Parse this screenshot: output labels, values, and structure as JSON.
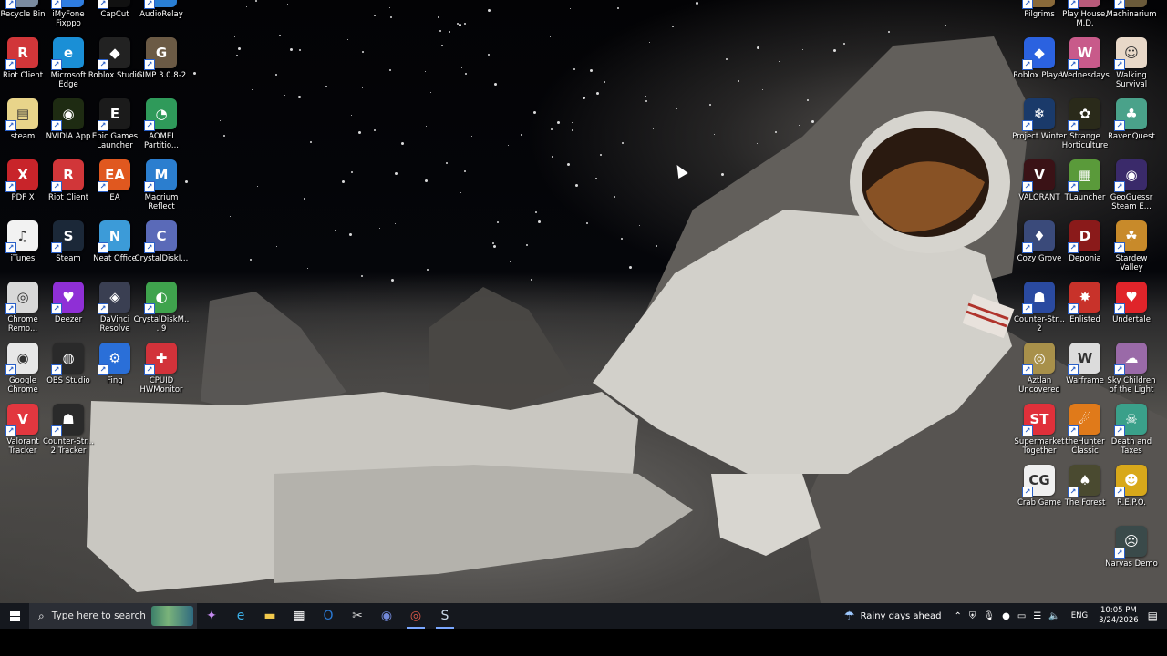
{
  "left_icons": [
    {
      "label": "Recycle Bin",
      "icon": "recycle-bin-icon",
      "color": "#7a8ba0",
      "glyph": "🗑"
    },
    {
      "label": "iMyFone Fixppo",
      "icon": "imyfone-fixppo-icon",
      "color": "#2f7de1",
      "glyph": "F"
    },
    {
      "label": "CapCut",
      "icon": "capcut-icon",
      "color": "#111111",
      "glyph": "✂"
    },
    {
      "label": "AudioRelay",
      "icon": "audiorelay-icon",
      "color": "#2a7fd4",
      "glyph": "♪"
    },
    {
      "label": "Riot Client",
      "icon": "riot-client-icon",
      "color": "#d13639",
      "glyph": "R"
    },
    {
      "label": "Microsoft Edge",
      "icon": "microsoft-edge-icon",
      "color": "#1a8fd6",
      "glyph": "e"
    },
    {
      "label": "Roblox Studio",
      "icon": "roblox-studio-icon",
      "color": "#222222",
      "glyph": "◆"
    },
    {
      "label": "GIMP 3.0.8-2",
      "icon": "gimp-icon",
      "color": "#6b5a45",
      "glyph": "G"
    },
    {
      "label": "steam",
      "icon": "folder-icon",
      "color": "#e8d48a",
      "glyph": "▤"
    },
    {
      "label": "NVIDIA App",
      "icon": "nvidia-app-icon",
      "color": "#1e2b12",
      "glyph": "◉"
    },
    {
      "label": "Epic Games Launcher",
      "icon": "epic-games-icon",
      "color": "#1b1b1b",
      "glyph": "E"
    },
    {
      "label": "AOMEI Partitio...",
      "icon": "aomei-partition-icon",
      "color": "#2f9a5a",
      "glyph": "◔"
    },
    {
      "label": "PDF X",
      "icon": "pdf-x-icon",
      "color": "#c8242a",
      "glyph": "X"
    },
    {
      "label": "Riot Client",
      "icon": "riot-client-icon",
      "color": "#d13639",
      "glyph": "R"
    },
    {
      "label": "EA",
      "icon": "ea-icon",
      "color": "#e0581f",
      "glyph": "EA"
    },
    {
      "label": "Macrium Reflect",
      "icon": "macrium-reflect-icon",
      "color": "#2b7ecf",
      "glyph": "M"
    },
    {
      "label": "iTunes",
      "icon": "itunes-icon",
      "color": "#f2f2f2",
      "glyph": "♫"
    },
    {
      "label": "Steam",
      "icon": "steam-icon",
      "color": "#1b2838",
      "glyph": "S"
    },
    {
      "label": "Neat Office",
      "icon": "neat-office-icon",
      "color": "#3c9bd8",
      "glyph": "N"
    },
    {
      "label": "CrystalDiskI...",
      "icon": "crystaldiskinfo-icon",
      "color": "#5a6ab8",
      "glyph": "C"
    },
    {
      "label": "Chrome Remo...",
      "icon": "chrome-remote-icon",
      "color": "#d8d8d8",
      "glyph": "◎"
    },
    {
      "label": "Deezer",
      "icon": "deezer-icon",
      "color": "#8f2fd6",
      "glyph": "♥"
    },
    {
      "label": "DaVinci Resolve",
      "icon": "davinci-resolve-icon",
      "color": "#3a3f52",
      "glyph": "◈"
    },
    {
      "label": "CrystalDiskM... 9",
      "icon": "crystaldiskmark-icon",
      "color": "#3fa34d",
      "glyph": "◐"
    },
    {
      "label": "Google Chrome",
      "icon": "google-chrome-icon",
      "color": "#e7e7e7",
      "glyph": "◉"
    },
    {
      "label": "OBS Studio",
      "icon": "obs-studio-icon",
      "color": "#2a2a2a",
      "glyph": "◍"
    },
    {
      "label": "Fing",
      "icon": "fing-icon",
      "color": "#2a6fd8",
      "glyph": "⚙"
    },
    {
      "label": "CPUID HWMonitor",
      "icon": "cpuid-hwmonitor-icon",
      "color": "#d2323a",
      "glyph": "✚"
    },
    {
      "label": "Valorant Tracker",
      "icon": "valorant-tracker-icon",
      "color": "#e2373f",
      "glyph": "V"
    },
    {
      "label": "Counter-Str... 2 Tracker",
      "icon": "cs2-tracker-icon",
      "color": "#2a2a2a",
      "glyph": "☗"
    }
  ],
  "right_icons": [
    {
      "label": "Pilgrims",
      "icon": "pilgrims-icon",
      "color": "#8a6a3a",
      "glyph": "P"
    },
    {
      "label": "Play House, M.D.",
      "icon": "play-house-icon",
      "color": "#b85a7a",
      "glyph": "H"
    },
    {
      "label": "Machinarium",
      "icon": "machinarium-icon",
      "color": "#6a5a3a",
      "glyph": "M"
    },
    {
      "label": "Roblox Player",
      "icon": "roblox-player-icon",
      "color": "#2b62e0",
      "glyph": "◆"
    },
    {
      "label": "Wednesdays",
      "icon": "wednesdays-icon",
      "color": "#c85a8a",
      "glyph": "W"
    },
    {
      "label": "Walking Survival",
      "icon": "walking-survival-icon",
      "color": "#e8d8c8",
      "glyph": "☺"
    },
    {
      "label": "Project Winter",
      "icon": "project-winter-icon",
      "color": "#1a3a6a",
      "glyph": "❄"
    },
    {
      "label": "Strange Horticulture",
      "icon": "strange-horticulture-icon",
      "color": "#2a2a1a",
      "glyph": "✿"
    },
    {
      "label": "RavenQuest",
      "icon": "ravenquest-icon",
      "color": "#4aa28a",
      "glyph": "♣"
    },
    {
      "label": "VALORANT",
      "icon": "valorant-icon",
      "color": "#3a1216",
      "glyph": "V"
    },
    {
      "label": "TLauncher",
      "icon": "tlauncher-icon",
      "color": "#5a9a3a",
      "glyph": "▦"
    },
    {
      "label": "GeoGuessr Steam E...",
      "icon": "geoguessr-icon",
      "color": "#3a2a6a",
      "glyph": "◉"
    },
    {
      "label": "Cozy Grove",
      "icon": "cozy-grove-icon",
      "color": "#3a4a7a",
      "glyph": "♦"
    },
    {
      "label": "Deponia",
      "icon": "deponia-icon",
      "color": "#8a1a1a",
      "glyph": "D"
    },
    {
      "label": "Stardew Valley",
      "icon": "stardew-valley-icon",
      "color": "#c88a2a",
      "glyph": "☘"
    },
    {
      "label": "Counter-Str... 2",
      "icon": "counter-strike-2-icon",
      "color": "#2a4aa0",
      "glyph": "☗"
    },
    {
      "label": "Enlisted",
      "icon": "enlisted-icon",
      "color": "#c8322a",
      "glyph": "✸"
    },
    {
      "label": "Undertale",
      "icon": "undertale-icon",
      "color": "#e0242a",
      "glyph": "♥"
    },
    {
      "label": "Aztlan Uncovered",
      "icon": "aztlan-uncovered-icon",
      "color": "#a8904a",
      "glyph": "◎"
    },
    {
      "label": "Warframe",
      "icon": "warframe-icon",
      "color": "#dcdcdc",
      "glyph": "W"
    },
    {
      "label": "Sky Children of the Light",
      "icon": "sky-children-icon",
      "color": "#9a6aa8",
      "glyph": "☁"
    },
    {
      "label": "Supermarket Together",
      "icon": "supermarket-together-icon",
      "color": "#e0303a",
      "glyph": "ST"
    },
    {
      "label": "theHunter Classic",
      "icon": "thehunter-classic-icon",
      "color": "#e07a1a",
      "glyph": "☄"
    },
    {
      "label": "Death and Taxes",
      "icon": "death-and-taxes-icon",
      "color": "#3aa08a",
      "glyph": "☠"
    },
    {
      "label": "Crab Game",
      "icon": "crab-game-icon",
      "color": "#f0f0f0",
      "glyph": "CG"
    },
    {
      "label": "The Forest",
      "icon": "the-forest-icon",
      "color": "#4a4a30",
      "glyph": "♠"
    },
    {
      "label": "R.E.P.O.",
      "icon": "repo-icon",
      "color": "#d8a81a",
      "glyph": "☻"
    },
    {
      "label": "Narvas Demo",
      "icon": "narvas-demo-icon",
      "color": "#3a4a4a",
      "glyph": "☹"
    }
  ],
  "taskbar": {
    "search_placeholder": "Type here to search",
    "pinned": [
      {
        "name": "copilot-icon",
        "glyph": "✦",
        "color": "#c58af0"
      },
      {
        "name": "edge-taskbar-icon",
        "glyph": "e",
        "color": "#3bb0e8"
      },
      {
        "name": "file-explorer-icon",
        "glyph": "▬",
        "color": "#f2c94c"
      },
      {
        "name": "microsoft-store-icon",
        "glyph": "▦",
        "color": "#ffffff"
      },
      {
        "name": "outlook-icon",
        "glyph": "O",
        "color": "#2a7ad6"
      },
      {
        "name": "snipping-tool-icon",
        "glyph": "✂",
        "color": "#d8d8d8"
      },
      {
        "name": "discord-icon",
        "glyph": "◉",
        "color": "#7289da"
      },
      {
        "name": "chrome-taskbar-icon",
        "glyph": "◎",
        "color": "#e05a4a"
      },
      {
        "name": "steam-taskbar-icon",
        "glyph": "S",
        "color": "#c8d8e8"
      }
    ],
    "weather_text": "Rainy days ahead",
    "language": "ENG",
    "time": "10:05 PM",
    "date": "3/24/2026"
  }
}
